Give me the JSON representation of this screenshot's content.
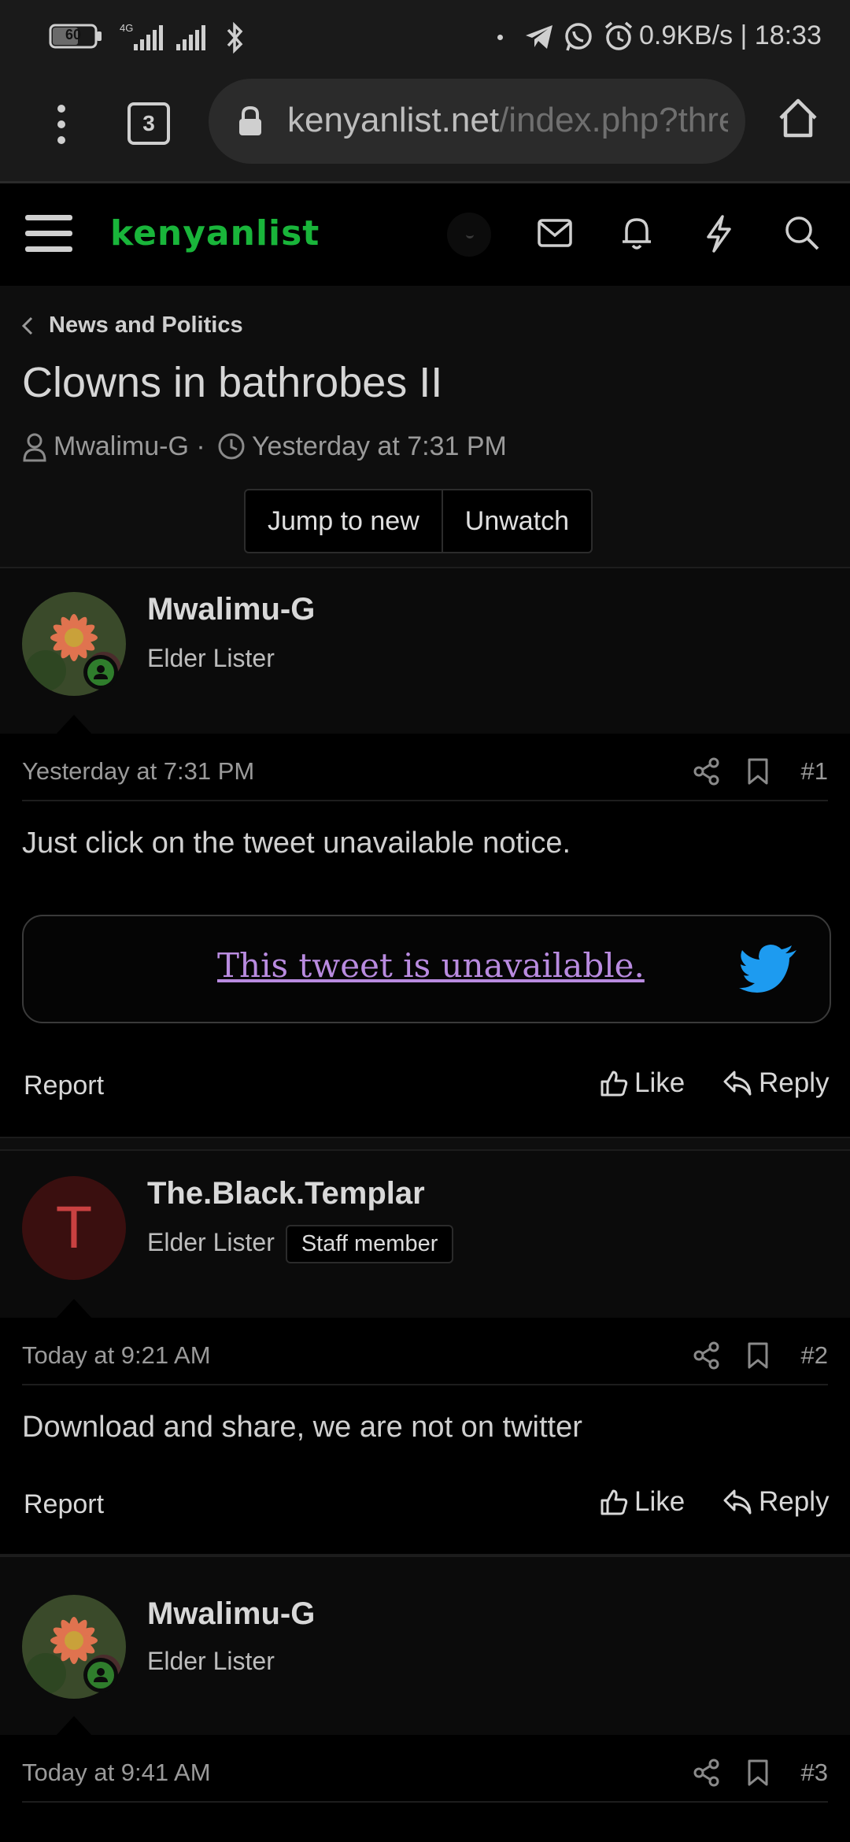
{
  "status": {
    "battery": "60",
    "network": "4G",
    "speed_time": "0.9KB/s | 18:33"
  },
  "browser": {
    "tab_count": "3",
    "url_host": "kenyanlist.net",
    "url_path": "/index.php?threa"
  },
  "site": {
    "logo": "kenyanlist"
  },
  "thread": {
    "breadcrumb": "News and Politics",
    "title": "Clowns in bathrobes II",
    "author": "Mwalimu-G",
    "separator": "·",
    "time": "Yesterday at 7:31 PM",
    "jump_label": "Jump to new",
    "unwatch_label": "Unwatch"
  },
  "posts": [
    {
      "user": "Mwalimu-G",
      "user_title": "Elder Lister",
      "time": "Yesterday at 7:31 PM",
      "number": "#1",
      "text": "Just click on the tweet unavailable notice.",
      "embed": "This tweet is unavailable.",
      "report": "Report",
      "like": "Like",
      "reply": "Reply"
    },
    {
      "user": "The.Black.Templar",
      "avatar_letter": "T",
      "user_title": "Elder Lister",
      "badge": "Staff member",
      "time": "Today at 9:21 AM",
      "number": "#2",
      "text": "Download and share, we are not on twitter",
      "report": "Report",
      "like": "Like",
      "reply": "Reply"
    },
    {
      "user": "Mwalimu-G",
      "user_title": "Elder Lister",
      "time": "Today at 9:41 AM",
      "number": "#3"
    }
  ],
  "colors": {
    "background": "#000000",
    "logo_green": "#19b53a",
    "link_purple": "#b98be0",
    "twitter_blue": "#1d9bf0",
    "online_green": "#2f7d2c",
    "avatar_red": "#3a0f0f"
  }
}
